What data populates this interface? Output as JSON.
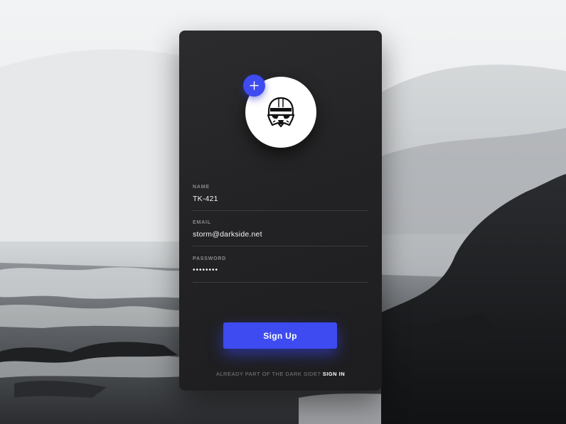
{
  "signup_card": {
    "avatar_icon": "stormtrooper-helmet-icon",
    "add_photo_icon": "plus-icon",
    "fields": {
      "name": {
        "label": "NAME",
        "value": "TK-421"
      },
      "email": {
        "label": "EMAIL",
        "value": "storm@darkside.net"
      },
      "password": {
        "label": "PASSWORD",
        "value": "••••••••"
      }
    },
    "signup_label": "Sign Up",
    "footer_prompt": "ALREADY PART OF THE DARK SIDE?",
    "signin_label": "SIGN IN"
  },
  "colors": {
    "accent": "#3d4bf0",
    "card_background": "#252527",
    "text_primary": "#f4f4f6",
    "text_muted": "#8a8a8e"
  }
}
